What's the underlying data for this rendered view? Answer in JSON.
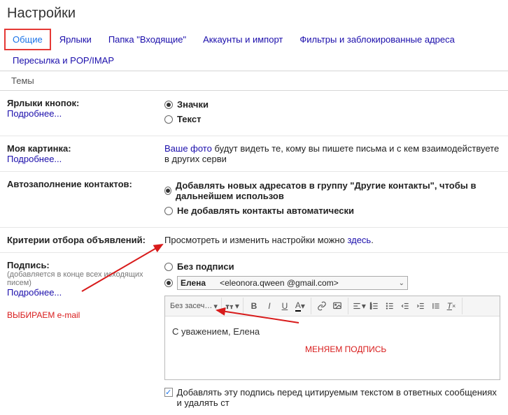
{
  "title": "Настройки",
  "tabs": [
    "Общие",
    "Ярлыки",
    "Папка \"Входящие\"",
    "Аккаунты и импорт",
    "Фильтры и заблокированные адреса",
    "Пересылка и POP/IMAP",
    "Темы"
  ],
  "active_tab": 0,
  "learn_more": "Подробнее...",
  "sections": {
    "button_labels": {
      "title": "Ярлыки кнопок:",
      "opt_icons": "Значки",
      "opt_text": "Текст"
    },
    "my_picture": {
      "title": "Моя картинка:",
      "link": "Ваше фото",
      "rest": " будут видеть те, кому вы пишете письма и с кем взаимодействуете в других серви"
    },
    "autocomplete": {
      "title": "Автозаполнение контактов:",
      "opt_add": "Добавлять новых адресатов в группу \"Другие контакты\", чтобы в дальнейшем использов",
      "opt_noadd": "Не добавлять контакты автоматически"
    },
    "ad_criteria": {
      "title": "Критерии отбора объявлений:",
      "text_pre": "Просмотреть и изменить настройки можно ",
      "link": "здесь",
      "text_post": "."
    },
    "signature": {
      "title": "Подпись:",
      "sub": "(добавляется в конце всех исходящих писем)",
      "opt_none": "Без подписи",
      "select_name": "Елена",
      "select_email": "<eleonora.qween  @gmail.com>",
      "font_label": "Без засеч…",
      "body": "С уважением, Елена",
      "checkbox_text": "Добавлять эту подпись перед цитируемым текстом в ответных сообщениях и удалять ст"
    }
  },
  "annotations": {
    "select_email": "ВЫБИРАЕМ e-mail",
    "change_sig": "МЕНЯЕМ ПОДПИСЬ"
  }
}
